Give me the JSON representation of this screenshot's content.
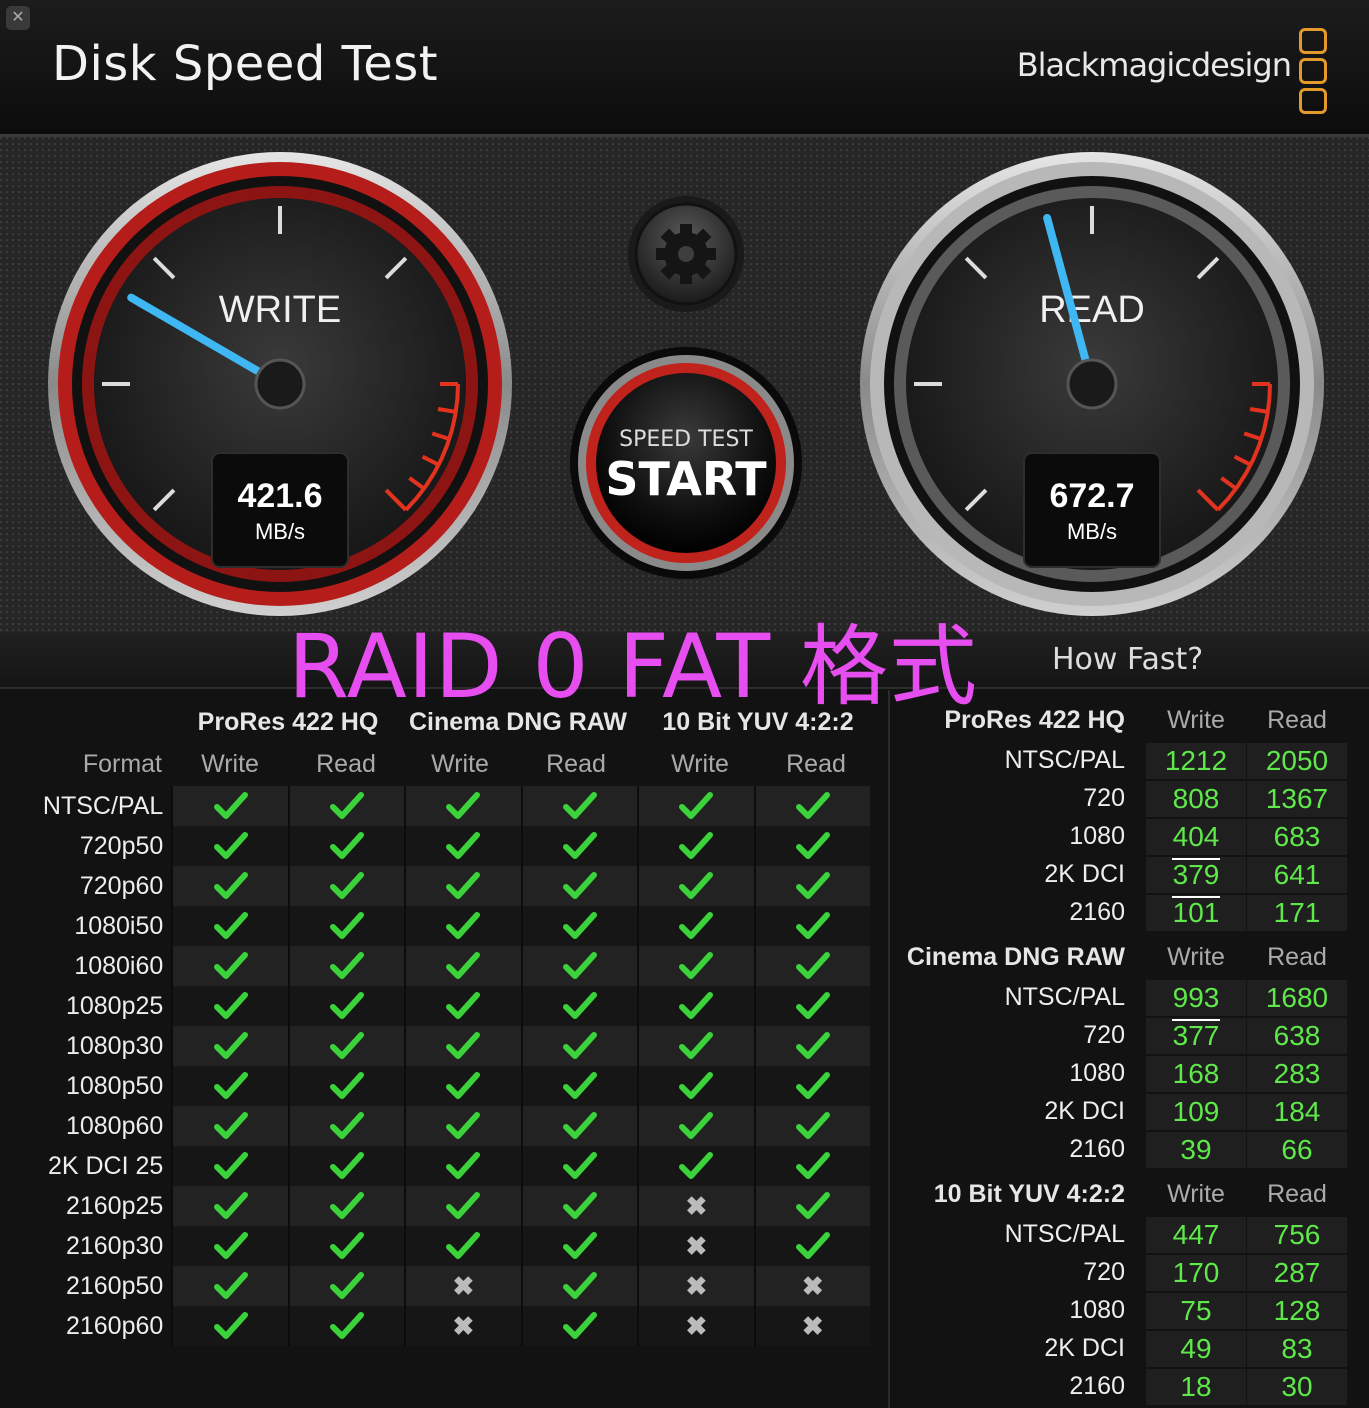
{
  "app": {
    "close": "✕",
    "title": "Disk Speed Test",
    "brand": "Blackmagicdesign",
    "brand_logo_icon": "three-rounded-squares"
  },
  "gauges": {
    "write": {
      "label": "WRITE",
      "value": "421.6",
      "unit": "MB/s",
      "speed": 421.6,
      "max_scale": 1000,
      "accent": "#c8201c"
    },
    "read": {
      "label": "READ",
      "value": "672.7",
      "unit": "MB/s",
      "speed": 672.7,
      "max_scale": 1000,
      "accent": "#9a9a9a"
    },
    "needle_color": "#3fb7f2",
    "settings_icon": "gear-icon"
  },
  "start_button": {
    "line1": "SPEED TEST",
    "line2": "START"
  },
  "overlay_label": "RAID 0  FAT 格式",
  "how_fast": "How Fast?",
  "compat": {
    "format_header": "Format",
    "groups": [
      "ProRes 422 HQ",
      "Cinema DNG RAW",
      "10 Bit YUV 4:2:2"
    ],
    "subcols": [
      "Write",
      "Read",
      "Write",
      "Read",
      "Write",
      "Read"
    ],
    "rows": [
      {
        "format": "NTSC/PAL",
        "marks": [
          1,
          1,
          1,
          1,
          1,
          1
        ]
      },
      {
        "format": "720p50",
        "marks": [
          1,
          1,
          1,
          1,
          1,
          1
        ]
      },
      {
        "format": "720p60",
        "marks": [
          1,
          1,
          1,
          1,
          1,
          1
        ]
      },
      {
        "format": "1080i50",
        "marks": [
          1,
          1,
          1,
          1,
          1,
          1
        ]
      },
      {
        "format": "1080i60",
        "marks": [
          1,
          1,
          1,
          1,
          1,
          1
        ]
      },
      {
        "format": "1080p25",
        "marks": [
          1,
          1,
          1,
          1,
          1,
          1
        ]
      },
      {
        "format": "1080p30",
        "marks": [
          1,
          1,
          1,
          1,
          1,
          1
        ]
      },
      {
        "format": "1080p50",
        "marks": [
          1,
          1,
          1,
          1,
          1,
          1
        ]
      },
      {
        "format": "1080p60",
        "marks": [
          1,
          1,
          1,
          1,
          1,
          1
        ]
      },
      {
        "format": "2K DCI 25",
        "marks": [
          1,
          1,
          1,
          1,
          1,
          1
        ]
      },
      {
        "format": "2160p25",
        "marks": [
          1,
          1,
          1,
          1,
          0,
          1
        ]
      },
      {
        "format": "2160p30",
        "marks": [
          1,
          1,
          1,
          1,
          0,
          1
        ]
      },
      {
        "format": "2160p50",
        "marks": [
          1,
          1,
          0,
          1,
          0,
          0
        ]
      },
      {
        "format": "2160p60",
        "marks": [
          1,
          1,
          0,
          1,
          0,
          0
        ]
      }
    ],
    "check_color": "#3cd23c",
    "cross_glyph": "✖"
  },
  "results": {
    "col_write": "Write",
    "col_read": "Read",
    "sections": [
      {
        "title": "ProRes 422 HQ",
        "rows": [
          {
            "label": "NTSC/PAL",
            "write": "1212",
            "read": "2050"
          },
          {
            "label": "720",
            "write": "808",
            "read": "1367"
          },
          {
            "label": "1080",
            "write": "404",
            "read": "683"
          },
          {
            "label": "2K DCI",
            "write": "379",
            "read": "641"
          },
          {
            "label": "2160",
            "write": "101",
            "read": "171"
          }
        ]
      },
      {
        "title": "Cinema DNG RAW",
        "rows": [
          {
            "label": "NTSC/PAL",
            "write": "993",
            "read": "1680"
          },
          {
            "label": "720",
            "write": "377",
            "read": "638"
          },
          {
            "label": "1080",
            "write": "168",
            "read": "283"
          },
          {
            "label": "2K DCI",
            "write": "109",
            "read": "184"
          },
          {
            "label": "2160",
            "write": "39",
            "read": "66"
          }
        ]
      },
      {
        "title": "10 Bit YUV 4:2:2",
        "rows": [
          {
            "label": "NTSC/PAL",
            "write": "447",
            "read": "756"
          },
          {
            "label": "720",
            "write": "170",
            "read": "287"
          },
          {
            "label": "1080",
            "write": "75",
            "read": "128"
          },
          {
            "label": "2K DCI",
            "write": "49",
            "read": "83"
          },
          {
            "label": "2160",
            "write": "18",
            "read": "30"
          }
        ]
      }
    ],
    "value_color": "#5fe84a"
  }
}
